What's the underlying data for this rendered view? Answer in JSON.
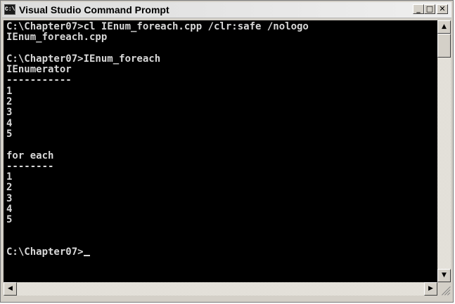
{
  "window": {
    "title": "Visual Studio Command Prompt",
    "icon_text": "C:\\",
    "controls": {
      "minimize": "_",
      "maximize": "□",
      "close": "✕"
    }
  },
  "console": {
    "text": "C:\\Chapter07>cl IEnum_foreach.cpp /clr:safe /nologo\nIEnum_foreach.cpp\n\nC:\\Chapter07>IEnum_foreach\nIEnumerator\n-----------\n1\n2\n3\n4\n5\n\nfor each\n--------\n1\n2\n3\n4\n5\n\n\nC:\\Chapter07>"
  },
  "scrollbars": {
    "up_arrow": "▲",
    "down_arrow": "▼",
    "left_arrow": "◀",
    "right_arrow": "▶"
  },
  "icons": [
    "console-app-icon",
    "minimize-icon",
    "maximize-icon",
    "close-icon",
    "resize-grip-icon"
  ],
  "colors": {
    "console_background": "#000000",
    "console_text": "#d8d8d8",
    "chrome": "#d4d0c8"
  }
}
